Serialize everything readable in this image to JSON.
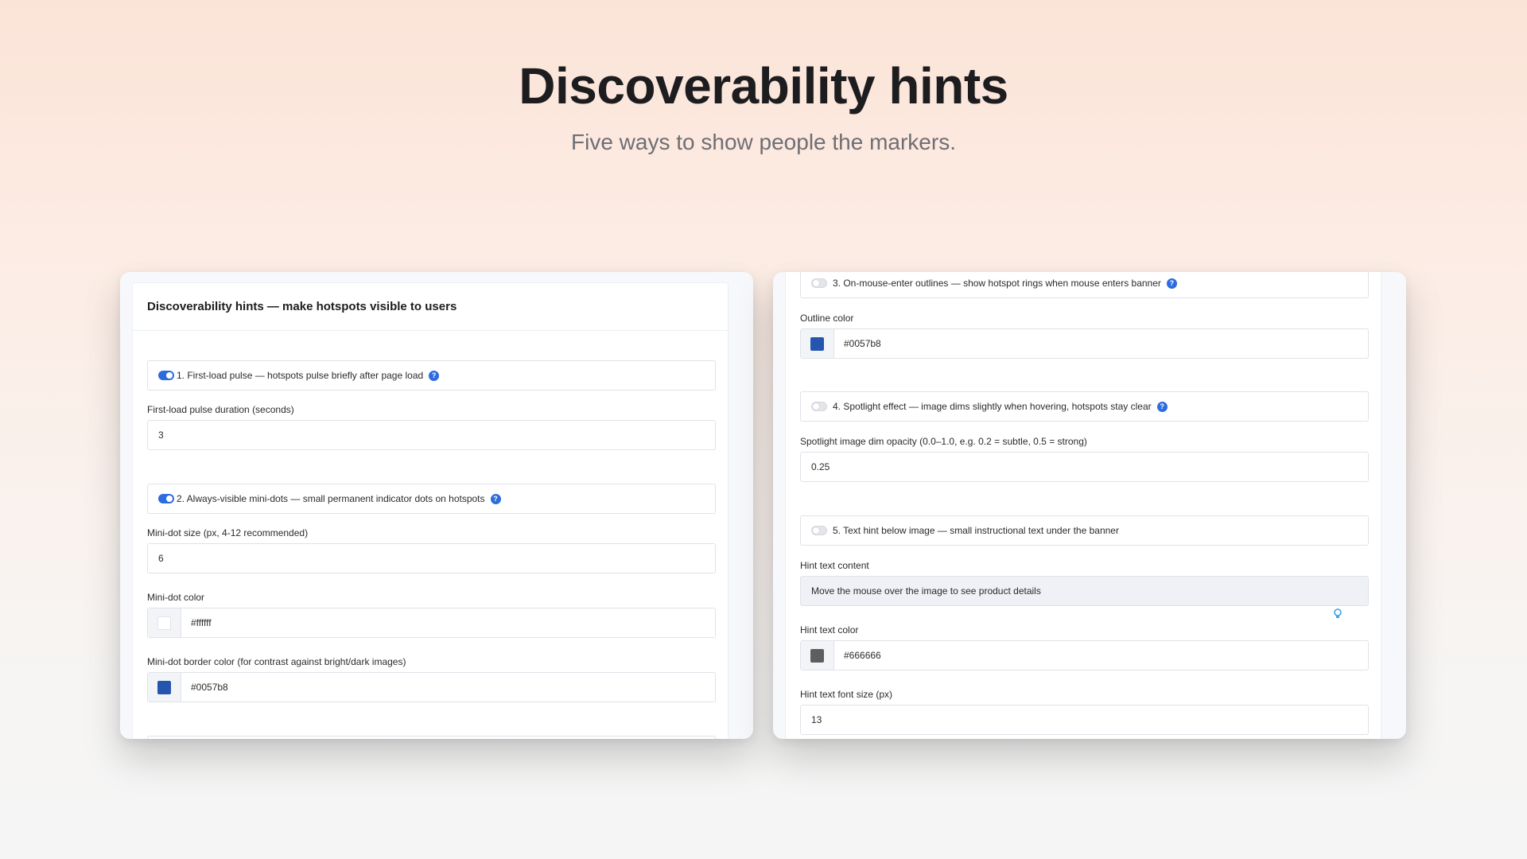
{
  "hero": {
    "title": "Discoverability hints",
    "subtitle": "Five ways to show people the markers."
  },
  "left_panel": {
    "card_title": "Discoverability hints — make hotspots visible to users",
    "toggle1": {
      "label": "1. First-load pulse — hotspots pulse briefly after page load",
      "on": true
    },
    "pulse_duration": {
      "label": "First-load pulse duration (seconds)",
      "value": "3"
    },
    "toggle2": {
      "label": "2. Always-visible mini-dots — small permanent indicator dots on hotspots",
      "on": true
    },
    "dot_size": {
      "label": "Mini-dot size (px, 4-12 recommended)",
      "value": "6"
    },
    "dot_color": {
      "label": "Mini-dot color",
      "value": "#ffffff",
      "swatch": "#ffffff"
    },
    "dot_border_color": {
      "label": "Mini-dot border color (for contrast against bright/dark images)",
      "value": "#0057b8",
      "swatch": "#2456b0"
    }
  },
  "right_panel": {
    "toggle3": {
      "label": "3. On-mouse-enter outlines — show hotspot rings when mouse enters banner",
      "on": false
    },
    "outline_color": {
      "label": "Outline color",
      "value": "#0057b8",
      "swatch": "#2456b0"
    },
    "toggle4": {
      "label": "4. Spotlight effect — image dims slightly when hovering, hotspots stay clear",
      "on": false
    },
    "spotlight_opacity": {
      "label": "Spotlight image dim opacity (0.0–1.0, e.g. 0.2 = subtle, 0.5 = strong)",
      "value": "0.25"
    },
    "toggle5": {
      "label": "5. Text hint below image — small instructional text under the banner",
      "on": false
    },
    "hint_text": {
      "label": "Hint text content",
      "value": "Move the mouse over the image to see product details"
    },
    "hint_color": {
      "label": "Hint text color",
      "value": "#666666",
      "swatch": "#5e5e5e"
    },
    "hint_font_size": {
      "label": "Hint text font size (px)",
      "value": "13"
    }
  },
  "icons": {
    "help": "question-circle-icon",
    "hint": "lightbulb-icon"
  },
  "colors": {
    "accent": "#2d6cdf"
  }
}
